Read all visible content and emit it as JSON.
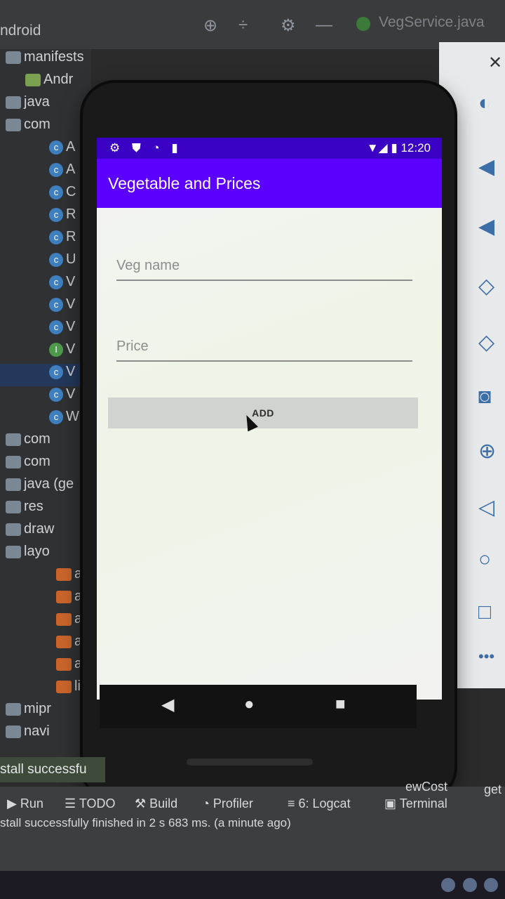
{
  "ide": {
    "project_view": "ndroid",
    "open_file": "VegService.java",
    "tree": [
      {
        "label": "manifests",
        "kind": "folder"
      },
      {
        "label": "Andr",
        "kind": "android"
      },
      {
        "label": "java",
        "kind": "folder"
      },
      {
        "label": "com",
        "kind": "folder"
      },
      {
        "label": "A",
        "kind": "class"
      },
      {
        "label": "A",
        "kind": "class"
      },
      {
        "label": "C",
        "kind": "class"
      },
      {
        "label": "R",
        "kind": "class"
      },
      {
        "label": "R",
        "kind": "class"
      },
      {
        "label": "U",
        "kind": "class"
      },
      {
        "label": "V",
        "kind": "class"
      },
      {
        "label": "V",
        "kind": "class"
      },
      {
        "label": "V",
        "kind": "class"
      },
      {
        "label": "V",
        "kind": "iface"
      },
      {
        "label": "V",
        "kind": "class"
      },
      {
        "label": "V",
        "kind": "class"
      },
      {
        "label": "W",
        "kind": "class"
      },
      {
        "label": "com",
        "kind": "folder"
      },
      {
        "label": "com",
        "kind": "folder"
      },
      {
        "label": "java (ge",
        "kind": "folder"
      },
      {
        "label": "res",
        "kind": "folder"
      },
      {
        "label": "draw",
        "kind": "folder"
      },
      {
        "label": "layo",
        "kind": "folder"
      },
      {
        "label": "a",
        "kind": "xml"
      },
      {
        "label": "a",
        "kind": "xml"
      },
      {
        "label": "a",
        "kind": "xml"
      },
      {
        "label": "a",
        "kind": "xml"
      },
      {
        "label": "a",
        "kind": "xml"
      },
      {
        "label": "li",
        "kind": "xml"
      },
      {
        "label": "mipr",
        "kind": "folder"
      },
      {
        "label": "navi",
        "kind": "folder"
      }
    ],
    "install_toast": "stall successfu",
    "bottom_tabs": [
      "Run",
      "TODO",
      "Build",
      "Profiler",
      "6: Logcat",
      "Terminal"
    ],
    "breadcrumb": [
      "ewCost",
      "get"
    ],
    "status_message": "stall successfully finished in 2 s 683 ms. (a minute ago)"
  },
  "device": {
    "status_left": "⚙ ⛊ ◔ ▮",
    "time": "12:20",
    "app_title": "Vegetable and Prices",
    "veg_name_placeholder": "Veg name",
    "price_placeholder": "Price",
    "add_label": "ADD"
  },
  "emulator_controls": [
    "power-icon",
    "volume-up-icon",
    "volume-down-icon",
    "rotate-left-icon",
    "rotate-right-icon",
    "camera-icon",
    "zoom-icon",
    "back-icon",
    "home-icon",
    "overview-icon",
    "more-icon"
  ],
  "colors": {
    "status_bar": "#3a00c4",
    "app_bar": "#5b00ff",
    "button": "#d1d3d0"
  }
}
